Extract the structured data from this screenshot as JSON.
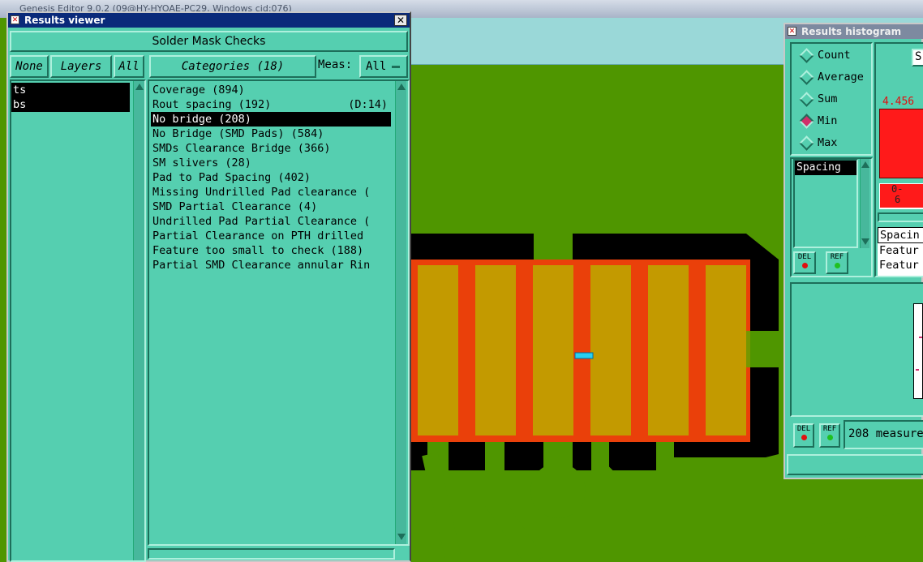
{
  "background_app": {
    "title": "Genesis Editor 9.0.2 (09@HY-HYOAE-PC29, Windows cid:076)"
  },
  "results_viewer": {
    "window_title": "Results viewer",
    "check_name": "Solder Mask Checks",
    "layer_buttons": {
      "none": "None",
      "layers": "Layers",
      "all": "All"
    },
    "layers": [
      "ts",
      "bs"
    ],
    "categories_button": "Categories (18)",
    "meas_label": "Meas:",
    "meas_value": "All",
    "categories": [
      {
        "label": "Coverage (894)",
        "extra": ""
      },
      {
        "label": "Rout spacing (192)",
        "extra": "(D:14)"
      },
      {
        "label": "No bridge (208)",
        "extra": ""
      },
      {
        "label": "No Bridge (SMD Pads) (584)",
        "extra": ""
      },
      {
        "label": "SMDs Clearance Bridge (366)",
        "extra": ""
      },
      {
        "label": "SM slivers (28)",
        "extra": ""
      },
      {
        "label": "Pad to Pad Spacing (402)",
        "extra": ""
      },
      {
        "label": "Missing Undrilled Pad clearance (",
        "extra": ""
      },
      {
        "label": "SMD Partial Clearance (4)",
        "extra": ""
      },
      {
        "label": "Undrilled Pad Partial Clearance (",
        "extra": ""
      },
      {
        "label": "Partial Clearance on PTH drilled",
        "extra": ""
      },
      {
        "label": "Feature too small to check (188)",
        "extra": ""
      },
      {
        "label": "Partial SMD Clearance annular Rin",
        "extra": ""
      }
    ],
    "selected_category_index": 2
  },
  "results_histogram": {
    "window_title": "Results histogram",
    "modes": [
      "Count",
      "Average",
      "Sum",
      "Min",
      "Max"
    ],
    "selected_mode": "Min",
    "list": [
      "Spacing"
    ],
    "del_label": "DEL",
    "ref_label": "REF",
    "bar_value": "4.456",
    "bin_label_1": "0-",
    "bin_label_2": "6",
    "top_button": "S",
    "legend": [
      "Spacin",
      "Featur",
      "Featur"
    ],
    "status": "208 measure"
  },
  "colors": {
    "panel": "#55cfb0",
    "selection": "#000000",
    "title_bar": "#0a2a7a",
    "board_green": "#4f9600",
    "copper_red": "#ff1010",
    "pad_gold": "#c39a00",
    "marker_cyan": "#2ad0f0"
  }
}
